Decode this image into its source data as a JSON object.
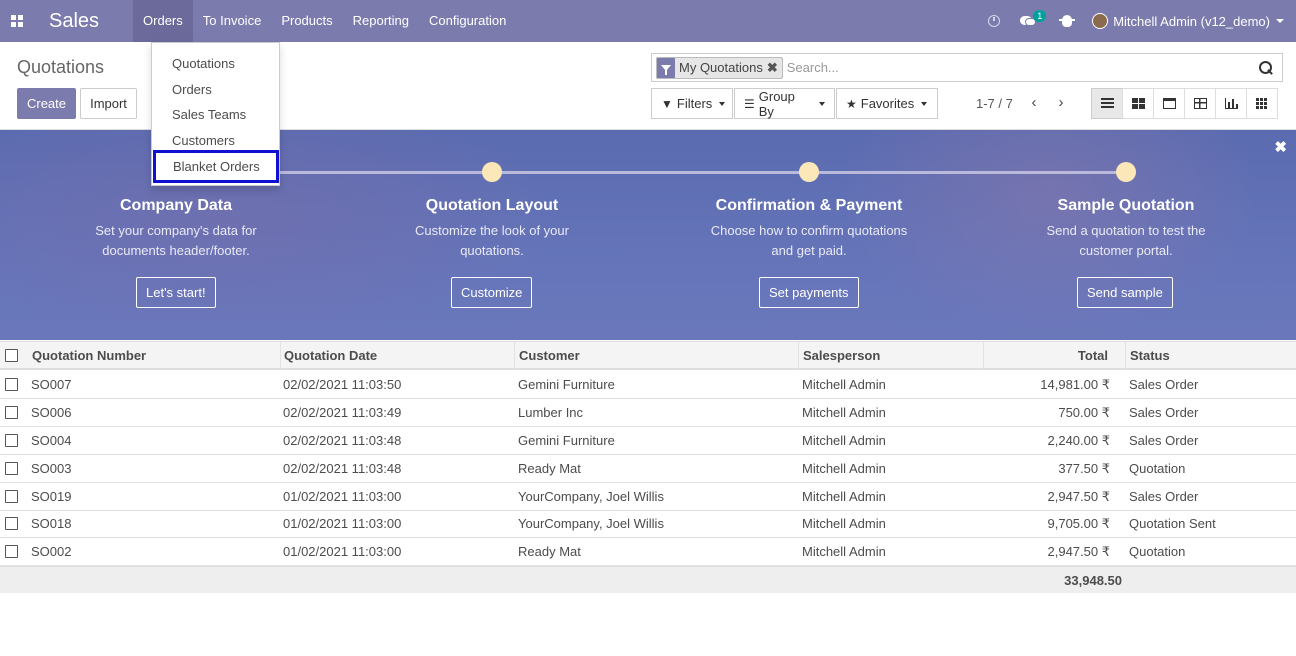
{
  "navbar": {
    "app_name": "Sales",
    "menus": [
      "Orders",
      "To Invoice",
      "Products",
      "Reporting",
      "Configuration"
    ],
    "chat_badge": "1",
    "user_name": "Mitchell Admin (v12_demo)"
  },
  "dropdown": {
    "items": [
      "Quotations",
      "Orders",
      "Sales Teams",
      "Customers",
      "Blanket Orders"
    ]
  },
  "control_panel": {
    "title": "Quotations",
    "create_label": "Create",
    "import_label": "Import",
    "facet_label": "My Quotations",
    "search_placeholder": "Search...",
    "filters_label": "Filters",
    "groupby_label": "Group By",
    "favorites_label": "Favorites",
    "pager": "1-7 / 7"
  },
  "banner": {
    "steps": [
      {
        "title": "Company Data",
        "desc1": "Set your company's data for",
        "desc2": "documents header/footer.",
        "button": "Let's start!"
      },
      {
        "title": "Quotation Layout",
        "desc1": "Customize the look of your",
        "desc2": "quotations.",
        "button": "Customize"
      },
      {
        "title": "Confirmation & Payment",
        "desc1": "Choose how to confirm quotations",
        "desc2": "and get paid.",
        "button": "Set payments"
      },
      {
        "title": "Sample Quotation",
        "desc1": "Send a quotation to test the",
        "desc2": "customer portal.",
        "button": "Send sample"
      }
    ]
  },
  "table": {
    "headers": [
      "Quotation Number",
      "Quotation Date",
      "Customer",
      "Salesperson",
      "Total",
      "Status"
    ],
    "rows": [
      {
        "number": "SO007",
        "date": "02/02/2021 11:03:50",
        "customer": "Gemini Furniture",
        "salesperson": "Mitchell Admin",
        "total": "14,981.00 ₹",
        "status": "Sales Order"
      },
      {
        "number": "SO006",
        "date": "02/02/2021 11:03:49",
        "customer": "Lumber Inc",
        "salesperson": "Mitchell Admin",
        "total": "750.00 ₹",
        "status": "Sales Order"
      },
      {
        "number": "SO004",
        "date": "02/02/2021 11:03:48",
        "customer": "Gemini Furniture",
        "salesperson": "Mitchell Admin",
        "total": "2,240.00 ₹",
        "status": "Sales Order"
      },
      {
        "number": "SO003",
        "date": "02/02/2021 11:03:48",
        "customer": "Ready Mat",
        "salesperson": "Mitchell Admin",
        "total": "377.50 ₹",
        "status": "Quotation"
      },
      {
        "number": "SO019",
        "date": "01/02/2021 11:03:00",
        "customer": "YourCompany, Joel Willis",
        "salesperson": "Mitchell Admin",
        "total": "2,947.50 ₹",
        "status": "Sales Order"
      },
      {
        "number": "SO018",
        "date": "01/02/2021 11:03:00",
        "customer": "YourCompany, Joel Willis",
        "salesperson": "Mitchell Admin",
        "total": "9,705.00 ₹",
        "status": "Quotation Sent"
      },
      {
        "number": "SO002",
        "date": "01/02/2021 11:03:00",
        "customer": "Ready Mat",
        "salesperson": "Mitchell Admin",
        "total": "2,947.50 ₹",
        "status": "Quotation"
      }
    ],
    "grand_total": "33,948.50"
  }
}
